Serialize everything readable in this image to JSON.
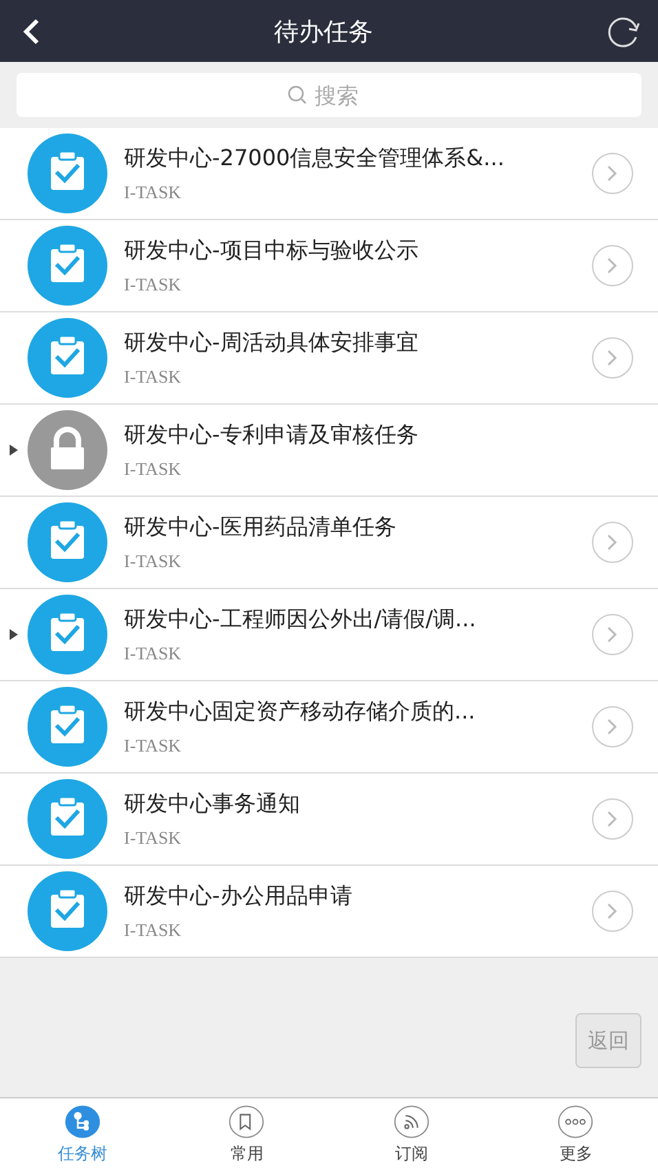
{
  "header": {
    "title": "待办任务"
  },
  "search": {
    "placeholder": "搜索"
  },
  "tasks": [
    {
      "kind": "task",
      "title": "研发中心-27000信息安全管理体系&...",
      "subtitle": "I-TASK",
      "expandable": false
    },
    {
      "kind": "task",
      "title": "研发中心-项目中标与验收公示",
      "subtitle": "I-TASK",
      "expandable": false
    },
    {
      "kind": "task",
      "title": "研发中心-周活动具体安排事宜",
      "subtitle": "I-TASK",
      "expandable": false
    },
    {
      "kind": "locked",
      "title": "研发中心-专利申请及审核任务",
      "subtitle": "I-TASK",
      "expandable": true
    },
    {
      "kind": "task",
      "title": "研发中心-医用药品清单任务",
      "subtitle": "I-TASK",
      "expandable": false
    },
    {
      "kind": "task",
      "title": "研发中心-工程师因公外出/请假/调...",
      "subtitle": "I-TASK",
      "expandable": true
    },
    {
      "kind": "task",
      "title": "研发中心固定资产移动存储介质的...",
      "subtitle": "I-TASK",
      "expandable": false
    },
    {
      "kind": "task",
      "title": "研发中心事务通知",
      "subtitle": "I-TASK",
      "expandable": false
    },
    {
      "kind": "task",
      "title": "研发中心-办公用品申请",
      "subtitle": "I-TASK",
      "expandable": false
    }
  ],
  "back_button": "返回",
  "tabs": [
    {
      "kind": "tree",
      "label": "任务树",
      "selected": true
    },
    {
      "kind": "bookmark",
      "label": "常用",
      "selected": false
    },
    {
      "kind": "feed",
      "label": "订阅",
      "selected": false
    },
    {
      "kind": "more",
      "label": "更多",
      "selected": false
    }
  ]
}
